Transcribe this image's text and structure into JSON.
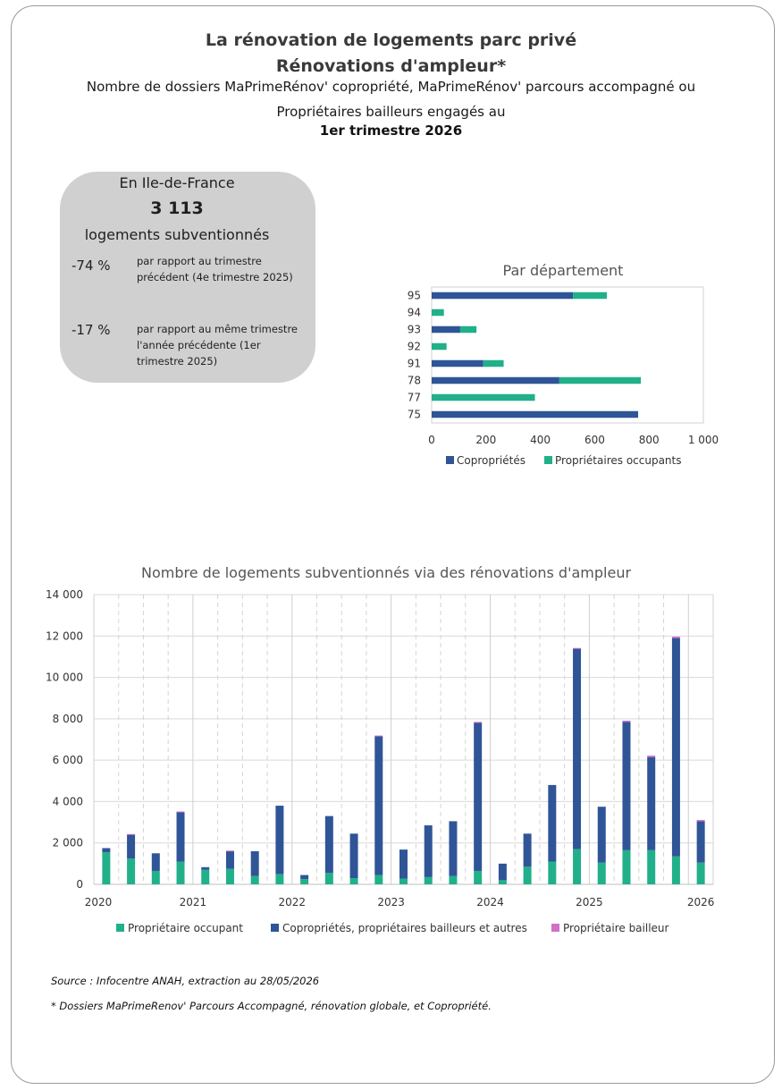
{
  "header": {
    "title_line1": "La rénovation de logements parc privé",
    "title_line2": "Rénovations d'ampleur*",
    "subtitle_line1": "Nombre de dossiers MaPrimeRénov' copropriété, MaPrimeRénov' parcours accompagné ou",
    "subtitle_line2": "Propriétaires bailleurs engagés au",
    "period": "1er trimestre 2026"
  },
  "kpi": {
    "region": "En Ile-de-France",
    "value": "3 113",
    "label": "logements subventionnés",
    "comparisons": [
      {
        "pct": "-74 %",
        "text": "par rapport au trimestre précédent (4e trimestre 2025)"
      },
      {
        "pct": "-17 %",
        "text": "par rapport au même trimestre l'année précédente (1er trimestre 2025)"
      }
    ]
  },
  "colors": {
    "copro": "#2f5597",
    "occupant": "#21b08a",
    "bailleur": "#d070c8"
  },
  "chart_data": [
    {
      "type": "bar",
      "orientation": "horizontal",
      "stacked": true,
      "title": "Par département",
      "categories": [
        "95",
        "94",
        "93",
        "92",
        "91",
        "78",
        "77",
        "75"
      ],
      "series": [
        {
          "name": "Copropriétés",
          "color": "#2f5597",
          "values": [
            520,
            0,
            105,
            0,
            190,
            470,
            0,
            760
          ]
        },
        {
          "name": "Propriétaires occupants",
          "color": "#21b08a",
          "values": [
            125,
            45,
            60,
            55,
            75,
            300,
            380,
            0
          ]
        }
      ],
      "xlim": [
        0,
        1000
      ],
      "xticks": [
        0,
        200,
        400,
        600,
        800,
        1000
      ],
      "xtick_labels": [
        "0",
        "200",
        "400",
        "600",
        "800",
        "1 000"
      ],
      "grid": false,
      "legend": "bottom"
    },
    {
      "type": "bar",
      "stacked": true,
      "title": "Nombre de logements subventionnés via des rénovations d'ampleur",
      "categories": [
        "2020-T1",
        "2020-T2",
        "2020-T3",
        "2020-T4",
        "2021-T1",
        "2021-T2",
        "2021-T3",
        "2021-T4",
        "2022-T1",
        "2022-T2",
        "2022-T3",
        "2022-T4",
        "2023-T1",
        "2023-T2",
        "2023-T3",
        "2023-T4",
        "2024-T1",
        "2024-T2",
        "2024-T3",
        "2024-T4",
        "2025-T1",
        "2025-T2",
        "2025-T3",
        "2025-T4",
        "2026-T1"
      ],
      "year_labels": [
        "2020",
        "2021",
        "2022",
        "2023",
        "2024",
        "2025",
        "2026"
      ],
      "series": [
        {
          "name": "Propriétaire occupant",
          "color": "#21b08a",
          "values": [
            1550,
            1250,
            650,
            1100,
            700,
            750,
            400,
            500,
            250,
            550,
            300,
            450,
            280,
            350,
            400,
            650,
            200,
            850,
            1100,
            1700,
            1050,
            1650,
            1650,
            1350,
            1050
          ]
        },
        {
          "name": "Copropriétés, propriétaires bailleurs et autres",
          "color": "#2f5597",
          "values": [
            200,
            1150,
            850,
            2400,
            130,
            850,
            1200,
            3300,
            200,
            2750,
            2150,
            6700,
            1400,
            2500,
            2650,
            7150,
            800,
            1600,
            3700,
            9700,
            2700,
            6200,
            4500,
            10550,
            2000
          ]
        },
        {
          "name": "Propriétaire bailleur",
          "color": "#d070c8",
          "values": [
            0,
            30,
            0,
            20,
            0,
            30,
            0,
            0,
            0,
            0,
            0,
            40,
            0,
            0,
            0,
            50,
            0,
            0,
            0,
            20,
            0,
            60,
            70,
            70,
            60
          ]
        }
      ],
      "ylim": [
        0,
        14000
      ],
      "yticks": [
        0,
        2000,
        4000,
        6000,
        8000,
        10000,
        12000,
        14000
      ],
      "ytick_labels": [
        "0",
        "2 000",
        "4 000",
        "6 000",
        "8 000",
        "10 000",
        "12 000",
        "14 000"
      ],
      "grid": true,
      "legend": "bottom"
    }
  ],
  "footer": {
    "source": "Source : Infocentre ANAH, extraction au 28/05/2026",
    "note": "* Dossiers MaPrimeRenov' Parcours Accompagné, rénovation globale, et  Copropriété."
  }
}
